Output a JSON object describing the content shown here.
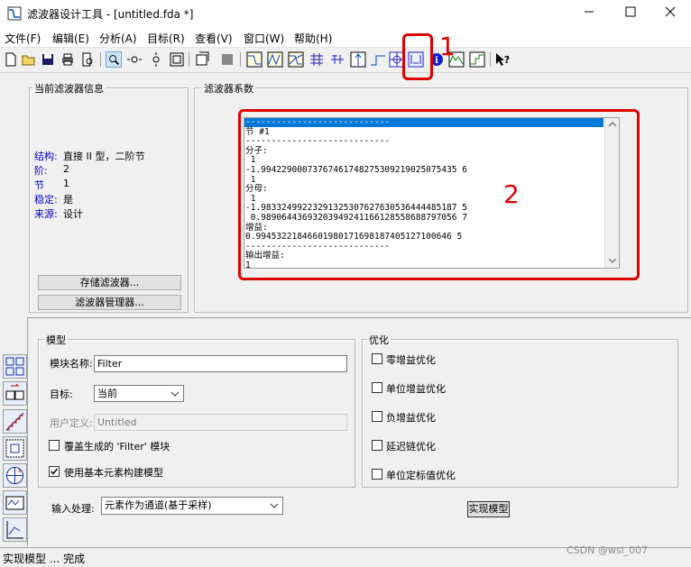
{
  "window": {
    "title": "滤波器设计工具 - [untitled.fda *]"
  },
  "menu": [
    "文件(F)",
    "编辑(E)",
    "分析(A)",
    "目标(R)",
    "查看(V)",
    "窗口(W)",
    "帮助(H)"
  ],
  "annotations": {
    "n1": "1",
    "n2": "2"
  },
  "current_filter": {
    "legend": "当前滤波器信息",
    "rows": [
      {
        "label": "结构:",
        "value": "直接 II 型，二阶节"
      },
      {
        "label": "阶:",
        "value": "2"
      },
      {
        "label": "节",
        "value": "1"
      },
      {
        "label": "稳定:",
        "value": "是"
      },
      {
        "label": "来源:",
        "value": "设计"
      }
    ],
    "store_button": "存储滤波器...",
    "manager_button": "滤波器管理器..."
  },
  "coefficients": {
    "legend": "滤波器系数",
    "lines": [
      "----------------------------",
      "节 #1",
      "----------------------------",
      "分子:",
      " 1",
      "-1.99422900073767461748275309219025075435 6",
      " 1",
      "分母:",
      " 1",
      "-1.98332499223291325307627630536444485187 5",
      " 0.98906443693203949241166128558688797056 7",
      "增益:",
      "0.99453221846601980171698187405127100646 5",
      "----------------------------",
      "输出增益:",
      "1"
    ]
  },
  "model": {
    "legend": "模型",
    "block_name_label": "模块名称:",
    "block_name_value": "Filter",
    "target_label": "目标:",
    "target_value": "当前",
    "user_defined_label": "用户定义:",
    "user_defined_value": "Untitled",
    "overwrite_label": "覆盖生成的 'Filter' 模块",
    "overwrite_checked": false,
    "basic_elements_label": "使用基本元素构建模型",
    "basic_elements_checked": true
  },
  "optimization": {
    "legend": "优化",
    "options": [
      "零增益优化",
      "单位增益优化",
      "负增益优化",
      "延迟链优化",
      "单位定标值优化"
    ]
  },
  "input_processing": {
    "label": "输入处理:",
    "value": "元素作为通道(基于采样)"
  },
  "realize_button": "实现模型",
  "status": {
    "text": "实现模型 ... 完成",
    "watermark": "CSDN @wsl_007"
  },
  "colors": {
    "accent": "#0078d7",
    "annotation": "#e00000",
    "info_label": "#0000cc"
  }
}
